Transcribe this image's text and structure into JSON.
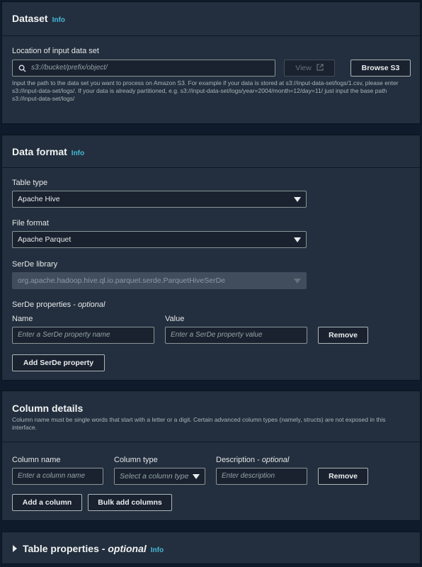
{
  "dataset": {
    "title": "Dataset",
    "info": "Info",
    "location_label": "Location of input data set",
    "location_placeholder": "s3://bucket/prefix/object/",
    "view_label": "View",
    "browse_label": "Browse S3",
    "help": "Input the path to the data set you want to process on Amazon S3. For example if your data is stored at s3://input-data-set/logs/1.csv, please enter s3://input-data-set/logs/. If your data is already partitioned, e.g. s3://input-data-set/logs/year=2004/month=12/day=11/ just input the base path s3://input-data-set/logs/"
  },
  "data_format": {
    "title": "Data format",
    "info": "Info",
    "table_type_label": "Table type",
    "table_type_value": "Apache Hive",
    "file_format_label": "File format",
    "file_format_value": "Apache Parquet",
    "serde_library_label": "SerDe library",
    "serde_library_value": "org.apache.hadoop.hive.ql.io.parquet.serde.ParquetHiveSerDe",
    "serde_props_label": "SerDe properties",
    "optional": "optional",
    "name_label": "Name",
    "value_label": "Value",
    "name_placeholder": "Enter a SerDe property name",
    "value_placeholder": "Enter a SerDe property value",
    "remove_label": "Remove",
    "add_label": "Add SerDe property"
  },
  "column_details": {
    "title": "Column details",
    "help": "Column name must be single words that start with a letter or a digit. Certain advanced column types (namely, structs) are not exposed in this interface.",
    "col_name_label": "Column name",
    "col_type_label": "Column type",
    "desc_label": "Description",
    "optional": "optional",
    "col_name_placeholder": "Enter a column name",
    "col_type_placeholder": "Select a column type",
    "desc_placeholder": "Enter description",
    "remove_label": "Remove",
    "add_column_label": "Add a column",
    "bulk_add_label": "Bulk add columns"
  },
  "table_properties": {
    "title": "Table properties",
    "optional": "optional",
    "info": "Info"
  }
}
